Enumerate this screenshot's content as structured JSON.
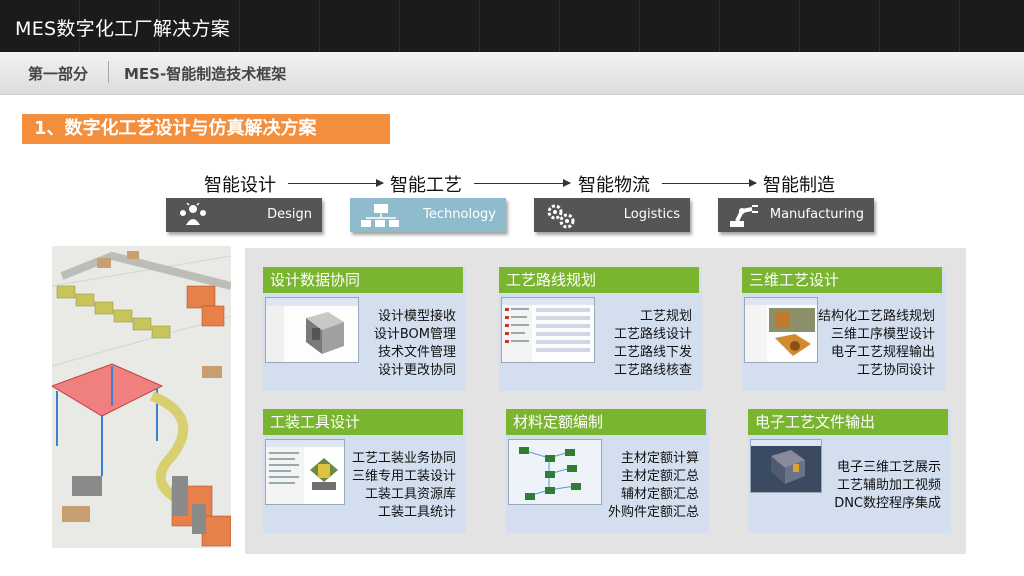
{
  "header": {
    "title": "MES数字化工厂解决方案"
  },
  "subheader": {
    "part": "第一部分",
    "subtitle": "MES-智能制造技术框架"
  },
  "section_title": "1、数字化工艺设计与仿真解决方案",
  "flow": {
    "steps": [
      {
        "label": "智能设计",
        "box_label": "Design",
        "color": "#555555",
        "icon": "people-idea-icon"
      },
      {
        "label": "智能工艺",
        "box_label": "Technology",
        "color": "#8fbccc",
        "icon": "network-icon"
      },
      {
        "label": "智能物流",
        "box_label": "Logistics",
        "color": "#555555",
        "icon": "gears-icon"
      },
      {
        "label": "智能制造",
        "box_label": "Manufacturing",
        "color": "#555555",
        "icon": "robot-arm-icon"
      }
    ]
  },
  "cards": [
    {
      "title": "设计数据协同",
      "items": [
        "设计模型接收",
        "设计BOM管理",
        "技术文件管理",
        "设计更改协同"
      ],
      "screenshot": "cad-model-screenshot"
    },
    {
      "title": "工艺路线规划",
      "items": [
        "工艺规划",
        "工艺路线设计",
        "工艺路线下发",
        "工艺路线核查"
      ],
      "screenshot": "process-route-screenshot"
    },
    {
      "title": "三维工艺设计",
      "items": [
        "结构化工艺路线规划",
        "三维工序模型设计",
        "电子工艺规程输出",
        "工艺协同设计"
      ],
      "screenshot": "3d-process-screenshot"
    },
    {
      "title": "工装工具设计",
      "items": [
        "工艺工装业务协同",
        "三维专用工装设计",
        "工装工具资源库",
        "工装工具统计"
      ],
      "screenshot": "tooling-screenshot"
    },
    {
      "title": "材料定额编制",
      "items": [
        "主材定额计算",
        "主材定额汇总",
        "辅材定额汇总",
        "外购件定额汇总"
      ],
      "screenshot": "material-quota-screenshot"
    },
    {
      "title": "电子工艺文件输出",
      "items": [
        "电子三维工艺展示",
        "工艺辅助加工视频",
        "DNC数控程序集成"
      ],
      "screenshot": "electronic-doc-screenshot"
    }
  ],
  "colors": {
    "accent_orange": "#f28e3c",
    "card_header_green": "#7ab52f",
    "card_bg": "#d3dfee",
    "topbar": "#1b1b1b"
  }
}
